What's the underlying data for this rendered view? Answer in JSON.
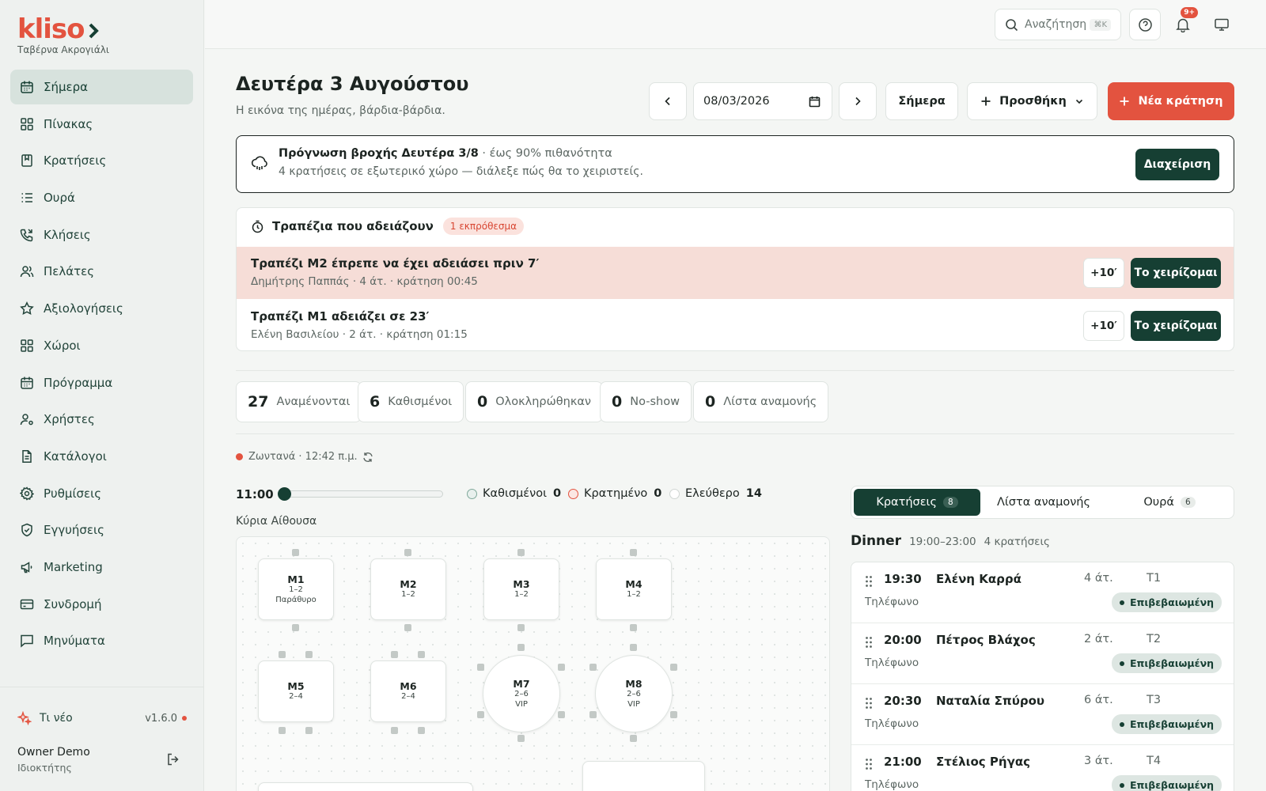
{
  "brand": {
    "logo": "kliso",
    "venue": "Ταβέρνα Ακρογιάλι"
  },
  "nav": [
    {
      "label": "Σήμερα",
      "icon": "calendar-icon",
      "active": true
    },
    {
      "label": "Πίνακας",
      "icon": "grid-icon"
    },
    {
      "label": "Κρατήσεις",
      "icon": "book-icon"
    },
    {
      "label": "Ουρά",
      "icon": "list-icon"
    },
    {
      "label": "Κλήσεις",
      "icon": "phone-icon"
    },
    {
      "label": "Πελάτες",
      "icon": "users-icon"
    },
    {
      "label": "Αξιολογήσεις",
      "icon": "star-icon"
    },
    {
      "label": "Χώροι",
      "icon": "grid-icon"
    },
    {
      "label": "Πρόγραμμα",
      "icon": "calendar-icon"
    },
    {
      "label": "Χρήστες",
      "icon": "user-cog-icon"
    },
    {
      "label": "Κατάλογοι",
      "icon": "file-icon"
    },
    {
      "label": "Ρυθμίσεις",
      "icon": "gear-icon"
    },
    {
      "label": "Εγγυήσεις",
      "icon": "shield-icon"
    },
    {
      "label": "Marketing",
      "icon": "megaphone-icon"
    },
    {
      "label": "Συνδρομή",
      "icon": "card-icon"
    },
    {
      "label": "Μηνύματα",
      "icon": "message-icon"
    }
  ],
  "sidebar_footer": {
    "whats_new": "Τι νέο",
    "version": "v1.6.0",
    "user_name": "Owner Demo",
    "user_role": "Ιδιοκτήτης"
  },
  "topbar": {
    "search_placeholder": "Αναζήτηση",
    "search_shortcut": "⌘K",
    "notifications_badge": "9+"
  },
  "header": {
    "title": "Δευτέρα 3 Αυγούστου",
    "subtitle": "Η εικόνα της ημέρας, βάρδια-βάρδια.",
    "date_value": "08/03/2026",
    "today_label": "Σήμερα",
    "add_label": "Προσθήκη",
    "new_booking_label": "Νέα κράτηση"
  },
  "alert": {
    "title": "Πρόγνωση βροχής Δευτέρα 3/8",
    "probability": "· έως 90% πιθανότητα",
    "text": "4 κρατήσεις σε εξωτερικό χώρο — διάλεξε πώς θα το χειριστείς.",
    "button": "Διαχείριση"
  },
  "turnover": {
    "title": "Τραπέζια που αδειάζουν",
    "badge": "1 εκπρόθεσμα",
    "rows": [
      {
        "title": "Τραπέζι Μ2 έπρεπε να έχει αδειάσει πριν 7′",
        "detail": "Δημήτρης Παππάς · 4 άτ. · κράτηση 00:45",
        "extend": "+10′",
        "handle": "Το χειρίζομαι"
      },
      {
        "title": "Τραπέζι Μ1 αδειάζει σε 23′",
        "detail": "Ελένη Βασιλείου · 2 άτ. · κράτηση 01:15",
        "extend": "+10′",
        "handle": "Το χειρίζομαι"
      }
    ]
  },
  "stats": [
    {
      "value": "27",
      "label": "Αναμένονται"
    },
    {
      "value": "6",
      "label": "Καθισμένοι"
    },
    {
      "value": "0",
      "label": "Ολοκληρώθηκαν"
    },
    {
      "value": "0",
      "label": "No-show"
    },
    {
      "value": "0",
      "label": "Λίστα αναμονής"
    }
  ],
  "live": {
    "label": "Ζωντανά",
    "time": "· 12:42 π.μ."
  },
  "timeline": {
    "time": "11:00",
    "slider_fraction": 0,
    "legend": [
      {
        "label": "Καθισμένοι",
        "count": "0"
      },
      {
        "label": "Κρατημένο",
        "count": "0"
      },
      {
        "label": "Ελεύθερο",
        "count": "14"
      }
    ]
  },
  "floor": {
    "room": "Κύρια Αίθουσα",
    "tables": [
      {
        "name": "Μ1",
        "seats": "1–2",
        "note": "Παράθυρο"
      },
      {
        "name": "Μ2",
        "seats": "1–2",
        "note": ""
      },
      {
        "name": "Μ3",
        "seats": "1–2",
        "note": ""
      },
      {
        "name": "Μ4",
        "seats": "1–2",
        "note": ""
      },
      {
        "name": "Μ5",
        "seats": "2–4",
        "note": ""
      },
      {
        "name": "Μ6",
        "seats": "2–4",
        "note": ""
      },
      {
        "name": "Μ7",
        "seats": "2–6",
        "note": "VIP"
      },
      {
        "name": "Μ8",
        "seats": "2–6",
        "note": "VIP"
      }
    ]
  },
  "tabs": [
    {
      "label": "Κρατήσεις",
      "count": "8"
    },
    {
      "label": "Λίστα αναμονής",
      "count": ""
    },
    {
      "label": "Ουρά",
      "count": "6"
    }
  ],
  "shift": {
    "name": "Dinner",
    "hours": "19:00–23:00",
    "count": "4 κρατήσεις"
  },
  "reservations": [
    {
      "time": "19:30",
      "name": "Ελένη Καρρά",
      "party": "4 άτ.",
      "table": "T1",
      "source": "Τηλέφωνο",
      "status": "Επιβεβαιωμένη"
    },
    {
      "time": "20:00",
      "name": "Πέτρος Βλάχος",
      "party": "2 άτ.",
      "table": "T2",
      "source": "Τηλέφωνο",
      "status": "Επιβεβαιωμένη"
    },
    {
      "time": "20:30",
      "name": "Ναταλία Σπύρου",
      "party": "6 άτ.",
      "table": "T3",
      "source": "Τηλέφωνο",
      "status": "Επιβεβαιωμένη"
    },
    {
      "time": "21:00",
      "name": "Στέλιος Ρήγας",
      "party": "3 άτ.",
      "table": "T4",
      "source": "Τηλέφωνο",
      "status": "Επιβεβαιωμένη"
    }
  ],
  "colors": {
    "brand": "#e3533f",
    "primary_dark": "#163f33",
    "late_row": "#f6ddd7",
    "seated": "#7fa89a",
    "reserved": "#e3533f",
    "free": "#d0d6d3"
  }
}
